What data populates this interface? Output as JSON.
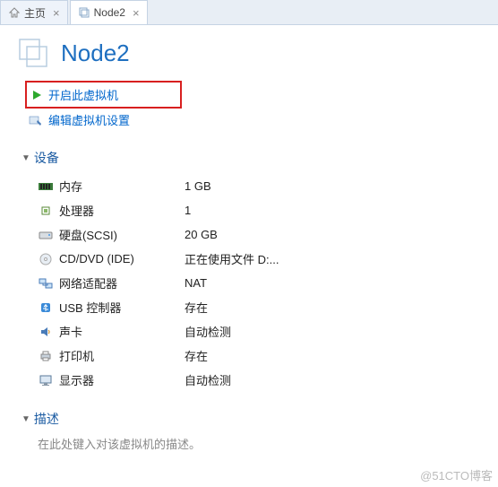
{
  "tabs": {
    "home": "主页",
    "node": "Node2"
  },
  "vm_title": "Node2",
  "actions": {
    "power_on": "开启此虚拟机",
    "edit_settings": "编辑虚拟机设置"
  },
  "sections": {
    "devices": "设备",
    "description": "描述"
  },
  "devices": [
    {
      "icon": "memory",
      "label": "内存",
      "value": "1 GB"
    },
    {
      "icon": "cpu",
      "label": "处理器",
      "value": "1"
    },
    {
      "icon": "disk",
      "label": "硬盘(SCSI)",
      "value": "20 GB"
    },
    {
      "icon": "cd",
      "label": "CD/DVD (IDE)",
      "value": "正在使用文件 D:..."
    },
    {
      "icon": "net",
      "label": "网络适配器",
      "value": "NAT"
    },
    {
      "icon": "usb",
      "label": "USB 控制器",
      "value": "存在"
    },
    {
      "icon": "sound",
      "label": "声卡",
      "value": "自动检测"
    },
    {
      "icon": "printer",
      "label": "打印机",
      "value": "存在"
    },
    {
      "icon": "display",
      "label": "显示器",
      "value": "自动检测"
    }
  ],
  "description_hint": "在此处键入对该虚拟机的描述。",
  "watermark": "@51CTO博客"
}
